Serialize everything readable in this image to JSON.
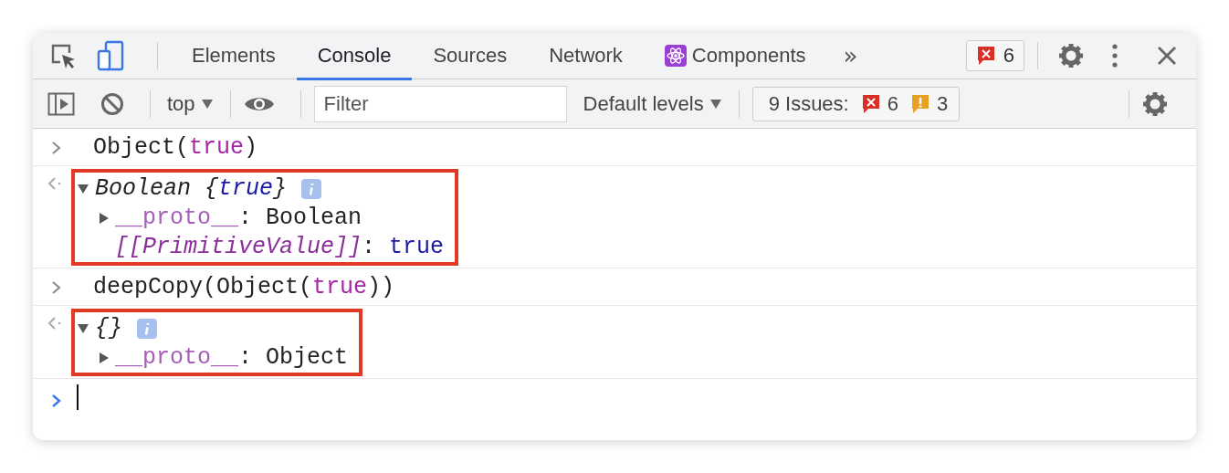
{
  "tabs": [
    {
      "label": "Elements",
      "selected": false,
      "kind": "plain"
    },
    {
      "label": "Console",
      "selected": true,
      "kind": "plain"
    },
    {
      "label": "Sources",
      "selected": false,
      "kind": "plain"
    },
    {
      "label": "Network",
      "selected": false,
      "kind": "plain"
    },
    {
      "label": "Components",
      "selected": false,
      "kind": "react"
    }
  ],
  "more_tabs": "»",
  "error_count": "6",
  "toolbar": {
    "context": "top",
    "filter": {
      "placeholder": "Filter"
    },
    "levels": "Default levels",
    "issues": {
      "label": "9 Issues:",
      "errors": "6",
      "warnings": "3"
    }
  },
  "console": [
    {
      "kind": "input",
      "lines": [
        {
          "tokens": [
            {
              "kind": "plain",
              "text": "Object("
            },
            {
              "kind": "keyword",
              "text": "true"
            },
            {
              "kind": "plain",
              "text": ")"
            }
          ]
        }
      ]
    },
    {
      "kind": "output",
      "highlighted": true,
      "lines": [
        {
          "expanded": true,
          "info": true,
          "tokens": [
            {
              "kind": "type",
              "text": "Boolean {"
            },
            {
              "kind": "typevalue",
              "text": "true"
            },
            {
              "kind": "type",
              "text": "}"
            }
          ]
        },
        {
          "expanded": false,
          "tokens": [
            {
              "kind": "key",
              "text": "__proto__"
            },
            {
              "kind": "plain",
              "text": ": Boolean"
            }
          ]
        },
        {
          "tokens": [
            {
              "kind": "internal",
              "text": "[[PrimitiveValue]]"
            },
            {
              "kind": "plain",
              "text": ": "
            },
            {
              "kind": "value",
              "text": "true"
            }
          ]
        }
      ]
    },
    {
      "kind": "input",
      "lines": [
        {
          "tokens": [
            {
              "kind": "plain",
              "text": "deepCopy(Object("
            },
            {
              "kind": "keyword",
              "text": "true"
            },
            {
              "kind": "plain",
              "text": "))"
            }
          ]
        }
      ]
    },
    {
      "kind": "output",
      "highlighted": true,
      "lines": [
        {
          "expanded": true,
          "info": true,
          "tokens": [
            {
              "kind": "type",
              "text": "{}"
            }
          ]
        },
        {
          "expanded": false,
          "tokens": [
            {
              "kind": "key",
              "text": "__proto__"
            },
            {
              "kind": "plain",
              "text": ": Object"
            }
          ]
        }
      ]
    },
    {
      "kind": "prompt"
    }
  ]
}
